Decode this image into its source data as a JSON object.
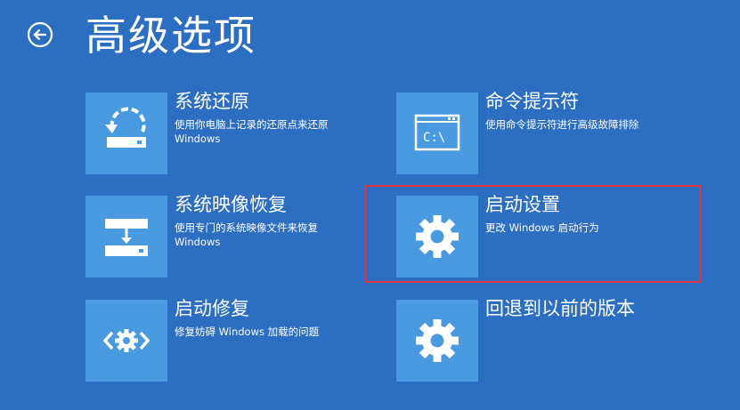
{
  "page": {
    "title": "高级选项",
    "background_color": "#2c6fc2",
    "tile_color": "#4a9ae0",
    "highlight_color": "#e1363f"
  },
  "back": {
    "icon": "back-arrow-icon"
  },
  "options": {
    "system_restore": {
      "label": "系统还原",
      "desc_line1": "使用你电脑上记录的还原点来还原",
      "desc_line2": "Windows",
      "icon": "system-restore-icon"
    },
    "command_prompt": {
      "label": "命令提示符",
      "desc_line1": "使用命令提示符进行高级故障排除",
      "desc_line2": "",
      "icon": "command-prompt-icon",
      "icon_text": "C:\\"
    },
    "system_image_recovery": {
      "label": "系统映像恢复",
      "desc_line1": "使用专门的系统映像文件来恢复",
      "desc_line2": "Windows",
      "icon": "system-image-icon"
    },
    "startup_settings": {
      "label": "启动设置",
      "desc_line1": "更改 Windows 启动行为",
      "desc_line2": "",
      "icon": "gear-icon",
      "highlighted": true
    },
    "startup_repair": {
      "label": "启动修复",
      "desc_line1": "修复妨碍 Windows 加载的问题",
      "desc_line2": "",
      "icon": "startup-repair-icon"
    },
    "go_back_previous": {
      "label": "回退到以前的版本",
      "desc_line1": "",
      "desc_line2": "",
      "icon": "gear-icon"
    }
  }
}
